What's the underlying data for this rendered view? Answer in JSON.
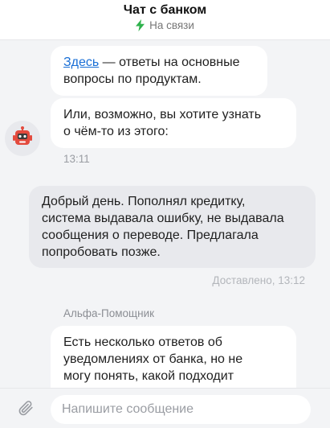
{
  "header": {
    "title": "Чат с банком",
    "status": "На связи",
    "status_icon": "bolt-icon",
    "status_color": "#2fb24c"
  },
  "messages": {
    "bot_1": {
      "link": "Здесь",
      "line1_rest": " — ответы на основные",
      "line2": "вопросы по продуктам."
    },
    "bot_2": {
      "line1": "Или, возможно, вы хотите узнать",
      "line2": "о чём-то из этого:",
      "time": "13:11"
    },
    "user_1": {
      "line1": "Добрый день. Пополнял кредитку,",
      "line2": "система выдавала ошибку, не выдавала",
      "line3": "сообщения о переводе. Предлагала",
      "line4": "попробовать позже.",
      "status": "Доставлено, 13:12"
    },
    "bot_3": {
      "sender": "Альфа-Помощник",
      "line1": "Есть несколько ответов об",
      "line2": "уведомлениях от банка, но не",
      "line3": "могу понять, какой подходит"
    }
  },
  "composer": {
    "placeholder": "Напишите сообщение",
    "attach_icon": "paperclip-icon"
  },
  "avatar_icon": "robot-icon"
}
